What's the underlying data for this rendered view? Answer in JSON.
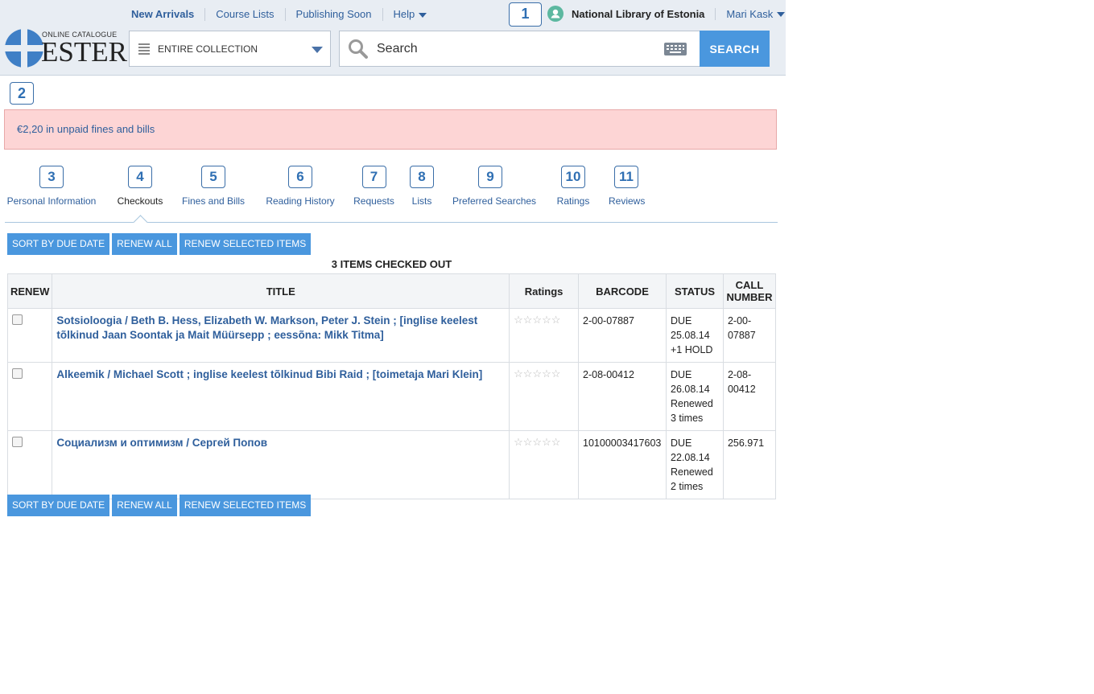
{
  "header": {
    "nav": [
      "New Arrivals",
      "Course Lists",
      "Publishing Soon",
      "Help"
    ],
    "library_name": "National Library of Estonia",
    "account_name": "Mari Kask",
    "logo_small": "ONLINE CATALOGUE",
    "logo_big": "ESTER",
    "scope_label": "ENTIRE COLLECTION",
    "search_placeholder": "Search",
    "search_button": "SEARCH",
    "badge_1": "1"
  },
  "badge_2": "2",
  "alert": "€2,20 in unpaid fines and bills",
  "tabs": [
    {
      "num": "3",
      "label": "Personal Information"
    },
    {
      "num": "4",
      "label": "Checkouts"
    },
    {
      "num": "5",
      "label": "Fines and Bills"
    },
    {
      "num": "6",
      "label": "Reading History"
    },
    {
      "num": "7",
      "label": "Requests"
    },
    {
      "num": "8",
      "label": "Lists"
    },
    {
      "num": "9",
      "label": "Preferred Searches"
    },
    {
      "num": "10",
      "label": "Ratings"
    },
    {
      "num": "11",
      "label": "Reviews"
    }
  ],
  "actions": {
    "sort": "SORT BY DUE DATE",
    "renew_all": "RENEW ALL",
    "renew_selected": "RENEW SELECTED ITEMS"
  },
  "count_label": "3 ITEMS CHECKED OUT",
  "table": {
    "headers": [
      "RENEW",
      "TITLE",
      "Ratings",
      "BARCODE",
      "STATUS",
      "CALL NUMBER"
    ],
    "rows": [
      {
        "title": "Sotsioloogia / Beth B. Hess, Elizabeth W. Markson, Peter J. Stein ; [inglise keelest tõlkinud Jaan Soontak ja Mait Müürsepp ; eessõna: Mikk Titma]",
        "barcode": "2-00-07887",
        "status": "DUE 25.08.14 +1 HOLD",
        "call_number": "2-00-07887"
      },
      {
        "title": "Alkeemik / Michael Scott ; inglise keelest tõlkinud Bibi Raid ; [toimetaja Mari Klein]",
        "barcode": "2-08-00412",
        "status": "DUE 26.08.14 Renewed 3 times",
        "call_number": "2-08-00412"
      },
      {
        "title": "Социализм и оптимизм / Сергей Попов",
        "barcode": "10100003417603",
        "status": "DUE 22.08.14 Renewed 2 times",
        "call_number": "256.971"
      }
    ]
  },
  "colors": {
    "accent": "#4a97de",
    "link": "#2f5f9c",
    "alert_bg": "#fdd5d5"
  }
}
